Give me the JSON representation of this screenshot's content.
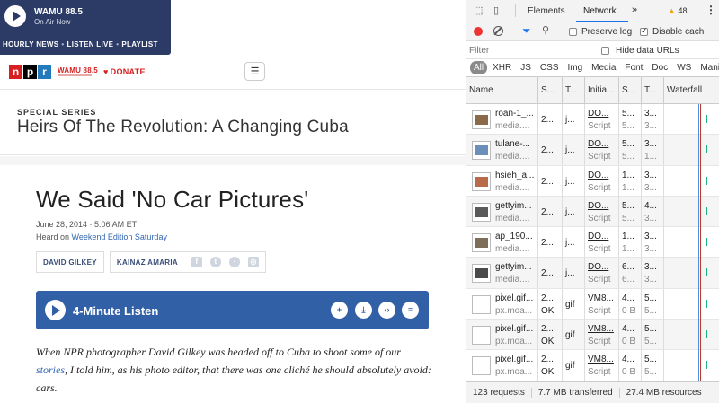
{
  "player": {
    "station": "WAMU 88.5",
    "status": "On Air Now",
    "links": [
      "HOURLY NEWS",
      "LISTEN LIVE",
      "PLAYLIST"
    ]
  },
  "header": {
    "logo_letters": [
      "n",
      "p",
      "r"
    ],
    "station_logo": "WAMU 88.5",
    "donate": "DONATE",
    "menu_icon": "hamburger-icon"
  },
  "series": {
    "kicker": "SPECIAL SERIES",
    "title": "Heirs Of The Revolution: A Changing Cuba"
  },
  "story": {
    "title": "We Said 'No Car Pictures'",
    "date": "June 28, 2014 · 5:06 AM ET",
    "heard_on_prefix": "Heard on",
    "heard_on_link": "Weekend Edition Saturday",
    "bylines": [
      "DAVID GILKEY",
      "KAINAZ AMARIA"
    ],
    "listen_label": "4-Minute Listen",
    "body_before_link": "When NPR photographer David Gilkey was headed off to Cuba to shoot some of our",
    "body_link": "stories",
    "body_after_link": ", I told him, as his photo editor, that there was one cliché he should absolutely avoid: cars."
  },
  "devtools": {
    "tabs": [
      "Elements",
      "Network"
    ],
    "active_tab": "Network",
    "more": "»",
    "warnings": "48",
    "preserve_log": "Preserve log",
    "disable_cache": "Disable cach",
    "filter_placeholder": "Filter",
    "hide_data_urls": "Hide data URLs",
    "types": [
      "All",
      "XHR",
      "JS",
      "CSS",
      "Img",
      "Media",
      "Font",
      "Doc",
      "WS",
      "Manifes"
    ],
    "columns": [
      "Name",
      "S...",
      "T...",
      "Initia...",
      "S...",
      "T...",
      "Waterfall"
    ],
    "rows": [
      {
        "name": "roan-1_...",
        "domain": "media....",
        "status": "2...",
        "type": "j...",
        "init": "DO...",
        "init2": "Script",
        "size": "5...",
        "size2": "5...",
        "time": "3...",
        "time2": "3...",
        "thumb": "photo"
      },
      {
        "name": "tulane-...",
        "domain": "media....",
        "status": "2...",
        "type": "j...",
        "init": "DO...",
        "init2": "Script",
        "size": "5...",
        "size2": "5...",
        "time": "3...",
        "time2": "1...",
        "thumb": "photo"
      },
      {
        "name": "hsieh_a...",
        "domain": "media....",
        "status": "2...",
        "type": "j...",
        "init": "DO...",
        "init2": "Script",
        "size": "1...",
        "size2": "1...",
        "time": "3...",
        "time2": "3...",
        "thumb": "photo"
      },
      {
        "name": "gettyim...",
        "domain": "media....",
        "status": "2...",
        "type": "j...",
        "init": "DO...",
        "init2": "Script",
        "size": "5...",
        "size2": "5...",
        "time": "4...",
        "time2": "3...",
        "thumb": "photo"
      },
      {
        "name": "ap_190...",
        "domain": "media....",
        "status": "2...",
        "type": "j...",
        "init": "DO...",
        "init2": "Script",
        "size": "1...",
        "size2": "1...",
        "time": "3...",
        "time2": "3...",
        "thumb": "photo"
      },
      {
        "name": "gettyim...",
        "domain": "media....",
        "status": "2...",
        "type": "j...",
        "init": "DO...",
        "init2": "Script",
        "size": "6...",
        "size2": "6...",
        "time": "3...",
        "time2": "3...",
        "thumb": "photo"
      },
      {
        "name": "pixel.gif...",
        "domain": "px.moa...",
        "status": "2...",
        "status2": "OK",
        "type": "gif",
        "init": "VM8...",
        "init2": "Script",
        "size": "4...",
        "size2": "0 B",
        "time": "5...",
        "time2": "5...",
        "thumb": "blank"
      },
      {
        "name": "pixel.gif...",
        "domain": "px.moa...",
        "status": "2...",
        "status2": "OK",
        "type": "gif",
        "init": "VM8...",
        "init2": "Script",
        "size": "4...",
        "size2": "0 B",
        "time": "5...",
        "time2": "5...",
        "thumb": "blank"
      },
      {
        "name": "pixel.gif...",
        "domain": "px.moa...",
        "status": "2...",
        "status2": "OK",
        "type": "gif",
        "init": "VM8...",
        "init2": "Script",
        "size": "4...",
        "size2": "0 B",
        "time": "5...",
        "time2": "5...",
        "thumb": "blank"
      }
    ],
    "summary": [
      "123 requests",
      "7.7 MB transferred",
      "27.4 MB resources"
    ]
  }
}
